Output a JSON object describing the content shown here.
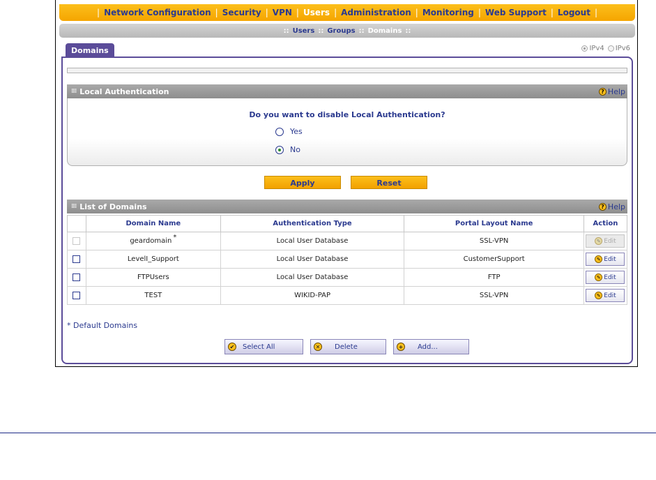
{
  "nav": {
    "items": [
      "Network Configuration",
      "Security",
      "VPN",
      "Users",
      "Administration",
      "Monitoring",
      "Web Support",
      "Logout"
    ],
    "active": "Users"
  },
  "subnav": {
    "users": "Users",
    "groups": "Groups",
    "domains": "Domains"
  },
  "tab": {
    "label": "Domains"
  },
  "ip": {
    "ipv4": "IPv4",
    "ipv6": "IPv6",
    "selected": "IPv4"
  },
  "local_auth": {
    "title": "Local Authentication",
    "help": "Help",
    "question": "Do you want to disable Local Authentication?",
    "yes": "Yes",
    "no": "No",
    "selected": "No"
  },
  "buttons": {
    "apply": "Apply",
    "reset": "Reset"
  },
  "domains": {
    "title": "List of Domains",
    "help": "Help",
    "columns": [
      "Domain Name",
      "Authentication Type",
      "Portal Layout Name",
      "Action"
    ],
    "rows": [
      {
        "name": "geardomain",
        "auth": "Local User Database",
        "portal": "SSL-VPN",
        "action": "Edit",
        "default": "*",
        "disabled": true
      },
      {
        "name": "LevelI_Support",
        "auth": "Local User Database",
        "portal": "CustomerSupport",
        "action": "Edit",
        "default": "",
        "disabled": false
      },
      {
        "name": "FTPUsers",
        "auth": "Local User Database",
        "portal": "FTP",
        "action": "Edit",
        "default": "",
        "disabled": false
      },
      {
        "name": "TEST",
        "auth": "WIKID-PAP",
        "portal": "SSL-VPN",
        "action": "Edit",
        "default": "",
        "disabled": false
      }
    ],
    "footnote": "* Default Domains"
  },
  "actions": {
    "select_all": "Select All",
    "delete": "Delete",
    "add": "Add..."
  },
  "colors": {
    "accent": "#fcbf1c",
    "nav_text": "#2b3a8f",
    "tab": "#5b4c99",
    "section_header": "#999999"
  }
}
